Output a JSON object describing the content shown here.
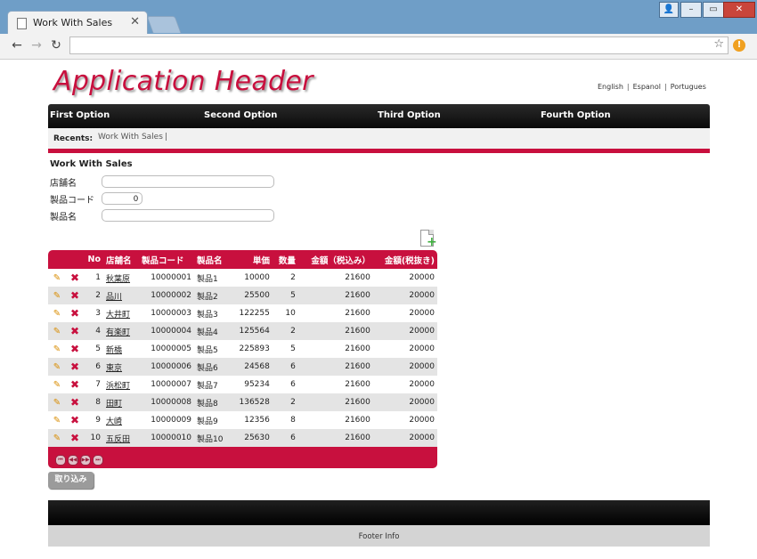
{
  "browser": {
    "tab_title": "Work With Sales",
    "tab_close": "✕",
    "url": "",
    "back": "←",
    "forward": "→",
    "reload": "↻",
    "star": "☆",
    "ext_badge": "!",
    "win_user": "👤",
    "win_min": "–",
    "win_max": "▭",
    "win_close": "✕"
  },
  "header": {
    "title": "Application Header",
    "languages": [
      "English",
      "Espanol",
      "Portugues"
    ]
  },
  "menu": [
    "First Option",
    "Second Option",
    "Third Option",
    "Fourth Option"
  ],
  "recents": {
    "label": "Recents:",
    "items": [
      "Work With Sales"
    ],
    "separator": "|"
  },
  "form": {
    "title": "Work With Sales",
    "fields": [
      {
        "label": "店舗名",
        "value": ""
      },
      {
        "label": "製品コード",
        "value": "0"
      },
      {
        "label": "製品名",
        "value": ""
      }
    ]
  },
  "grid": {
    "columns": [
      "",
      "",
      "No",
      "店舗名",
      "製品コード",
      "製品名",
      "単価",
      "数量",
      "金額（税込み）",
      "金額(税抜き)"
    ],
    "edit_icon": "✎",
    "delete_icon": "✖",
    "rows": [
      [
        "1",
        "秋葉原",
        "10000001",
        "製品1",
        "10000",
        "2",
        "21600",
        "20000"
      ],
      [
        "2",
        "品川",
        "10000002",
        "製品2",
        "25500",
        "5",
        "21600",
        "20000"
      ],
      [
        "3",
        "大井町",
        "10000003",
        "製品3",
        "122255",
        "10",
        "21600",
        "20000"
      ],
      [
        "4",
        "有楽町",
        "10000004",
        "製品4",
        "125564",
        "2",
        "21600",
        "20000"
      ],
      [
        "5",
        "新橋",
        "10000005",
        "製品5",
        "225893",
        "5",
        "21600",
        "20000"
      ],
      [
        "6",
        "東京",
        "10000006",
        "製品6",
        "24568",
        "6",
        "21600",
        "20000"
      ],
      [
        "7",
        "浜松町",
        "10000007",
        "製品7",
        "95234",
        "6",
        "21600",
        "20000"
      ],
      [
        "8",
        "田町",
        "10000008",
        "製品8",
        "136528",
        "2",
        "21600",
        "20000"
      ],
      [
        "9",
        "大崎",
        "10000009",
        "製品9",
        "12356",
        "8",
        "21600",
        "20000"
      ],
      [
        "10",
        "五反田",
        "10000010",
        "製品10",
        "25630",
        "6",
        "21600",
        "20000"
      ]
    ],
    "pager": [
      "⏮",
      "◀◀",
      "▶▶",
      "⏭"
    ]
  },
  "import_button": "取り込み",
  "footer": {
    "info": "Footer Info"
  },
  "colors": {
    "accent": "#c8103e",
    "menu_bg": "#111111",
    "row_alt": "#e4e4e4"
  }
}
